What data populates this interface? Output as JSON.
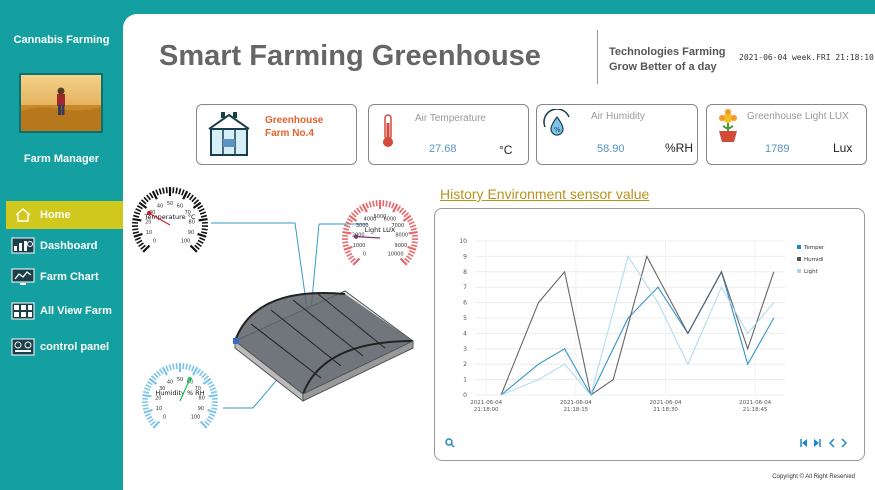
{
  "sidebar": {
    "app_title": "Cannabis Farming",
    "role": "Farm Manager",
    "items": [
      {
        "label": "Home",
        "icon": "home-icon",
        "active": true
      },
      {
        "label": "Dashboard",
        "icon": "dashboard-icon",
        "active": false
      },
      {
        "label": "Farm Chart",
        "icon": "chart-monitor-icon",
        "active": false
      },
      {
        "label": "All View Farm",
        "icon": "grid-view-icon",
        "active": false
      },
      {
        "label": "control panel",
        "icon": "control-panel-icon",
        "active": false
      }
    ]
  },
  "header": {
    "title": "Smart Farming Greenhouse",
    "tagline_line1": "Technologies Farming",
    "tagline_line2": "Grow Better of a day",
    "datetime": "2021-06-04  week.FRI  21:18:10"
  },
  "cards": {
    "farm": {
      "line1": "Greenhouse",
      "line2": "Farm No.4",
      "icon": "greenhouse-icon"
    },
    "temperature": {
      "label": "Air Temperature",
      "value": "27.68",
      "unit": "°C",
      "icon": "thermometer-icon"
    },
    "humidity": {
      "label": "Air Humidity",
      "value": "58.90",
      "unit": "%RH",
      "icon": "humidity-drop-icon"
    },
    "light": {
      "label": "Greenhouse Light LUX",
      "value": "1789",
      "unit": "Lux",
      "icon": "flower-pot-icon"
    }
  },
  "gauges": {
    "temperature": {
      "label": "Temperature °C",
      "min": 0,
      "max": 100,
      "value": 27.68,
      "color": "#111111",
      "ticks": [
        "0",
        "10",
        "20",
        "30",
        "40",
        "50",
        "60",
        "70",
        "80",
        "90",
        "100"
      ]
    },
    "light": {
      "label": "Light LUX",
      "min": 0,
      "max": 10000,
      "value": 1789,
      "color": "#e8676d",
      "ticks": [
        "0",
        "1000",
        "2000",
        "3000",
        "4000",
        "5000",
        "6000",
        "7000",
        "8000",
        "9000",
        "10000"
      ]
    },
    "humidity": {
      "label": "Humidity % RH",
      "min": 0,
      "max": 100,
      "value": 58.9,
      "color": "#7ec4ea",
      "ticks": [
        "0",
        "10",
        "20",
        "30",
        "40",
        "50",
        "60",
        "70",
        "80",
        "90",
        "100"
      ]
    }
  },
  "history": {
    "title": "History Environment sensor value"
  },
  "chart_data": {
    "type": "line",
    "x": [
      "2021-06-04 21:18:00",
      "2021-06-04 21:18:15",
      "2021-06-04 21:18:30",
      "2021-06-04 21:18:45"
    ],
    "x_tick_date": "2021-06-04",
    "x_tick_times": [
      "21:18:00",
      "21:18:15",
      "21:18:30",
      "21:18:45"
    ],
    "ylim": [
      0,
      10
    ],
    "yticks": [
      0,
      1,
      2,
      3,
      4,
      5,
      6,
      7,
      8,
      9,
      10
    ],
    "grid": true,
    "legend_position": "top-right",
    "series": [
      {
        "name": "Temper",
        "color": "#1e88c8",
        "points": [
          [
            0,
            0
          ],
          [
            1,
            2
          ],
          [
            1.7,
            3
          ],
          [
            2.4,
            0
          ],
          [
            3.4,
            5
          ],
          [
            4.2,
            7
          ],
          [
            5,
            4
          ],
          [
            5.9,
            8
          ],
          [
            6.6,
            2
          ],
          [
            7.3,
            5
          ]
        ]
      },
      {
        "name": "Humidi",
        "color": "#555555",
        "points": [
          [
            0,
            0
          ],
          [
            1,
            6
          ],
          [
            1.7,
            8
          ],
          [
            2.4,
            0
          ],
          [
            3.0,
            1
          ],
          [
            3.9,
            9
          ],
          [
            5,
            4
          ],
          [
            5.9,
            8
          ],
          [
            6.6,
            3
          ],
          [
            7.3,
            8
          ]
        ]
      },
      {
        "name": "Light",
        "color": "#a8d8ea",
        "points": [
          [
            0,
            0
          ],
          [
            1,
            1
          ],
          [
            1.7,
            2
          ],
          [
            2.4,
            0
          ],
          [
            3.4,
            9
          ],
          [
            4.2,
            6
          ],
          [
            5,
            2
          ],
          [
            5.9,
            7
          ],
          [
            6.6,
            4
          ],
          [
            7.3,
            6
          ]
        ]
      }
    ]
  },
  "chart_controls": {
    "zoom_icon": "magnifier-icon",
    "first": "first-page-icon",
    "last": "last-page-icon",
    "prev": "prev-icon",
    "next": "next-icon"
  },
  "footer": {
    "copyright": "Copyright © All Right Reserved"
  }
}
